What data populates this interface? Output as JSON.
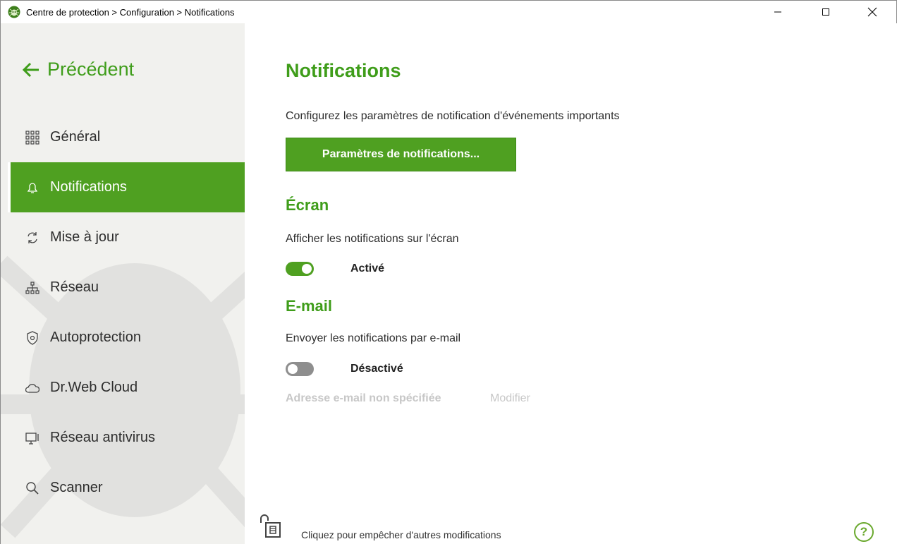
{
  "window": {
    "title": "Centre de protection > Configuration > Notifications",
    "controls": {
      "minimize": "—",
      "maximize": "☐",
      "close": "✕"
    }
  },
  "sidebar": {
    "back_label": "Précédent",
    "items": [
      {
        "label": "Général",
        "icon": "grid-icon",
        "active": false
      },
      {
        "label": "Notifications",
        "icon": "bell-icon",
        "active": true
      },
      {
        "label": "Mise à jour",
        "icon": "refresh-icon",
        "active": false
      },
      {
        "label": "Réseau",
        "icon": "network-icon",
        "active": false
      },
      {
        "label": "Autoprotection",
        "icon": "shield-icon",
        "active": false
      },
      {
        "label": "Dr.Web Cloud",
        "icon": "cloud-icon",
        "active": false
      },
      {
        "label": "Réseau antivirus",
        "icon": "monitor-icon",
        "active": false
      },
      {
        "label": "Scanner",
        "icon": "search-icon",
        "active": false
      }
    ]
  },
  "main": {
    "title": "Notifications",
    "description": "Configurez les paramètres de notification d'événements importants",
    "settings_button": "Paramètres de notifications...",
    "screen": {
      "title": "Écran",
      "label": "Afficher les notifications sur l'écran",
      "state": "Activé",
      "enabled": true
    },
    "email": {
      "title": "E-mail",
      "label": "Envoyer les notifications par e-mail",
      "state": "Désactivé",
      "enabled": false,
      "address": "Adresse e-mail non spécifiée",
      "modify": "Modifier"
    },
    "footer": {
      "lock_text": "Cliquez pour empêcher d'autres modifications",
      "help": "?"
    }
  },
  "colors": {
    "accent": "#4fa021",
    "accent_text": "#3f9d1a",
    "sidebar_bg": "#f1f1ee",
    "disabled_text": "#c7c7c7"
  }
}
